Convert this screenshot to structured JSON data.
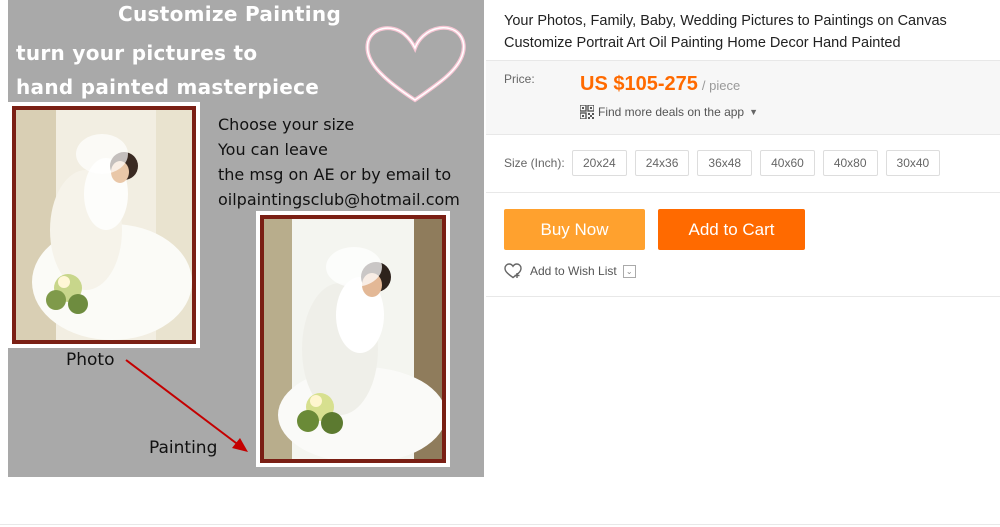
{
  "image": {
    "title": "Customize Painting",
    "subtitle_lines": [
      "turn your pictures to",
      "hand painted masterpiece"
    ],
    "instructions": [
      "Choose your size",
      "You can leave",
      "the msg on AE or by email to",
      "oilpaintingsclub@hotmail.com"
    ],
    "photo_label": "Photo",
    "painting_label": "Painting"
  },
  "product": {
    "title": "Your Photos, Family, Baby, Wedding Pictures to Paintings on Canvas Customize Portrait Art Oil Painting Home Decor Hand Painted",
    "price_label": "Price:",
    "price": "US $105-275",
    "price_unit": "/ piece",
    "app_deals": "Find more deals on the app",
    "size_label": "Size (Inch):",
    "sizes": [
      "20x24",
      "24x36",
      "36x48",
      "40x60",
      "40x80",
      "30x40"
    ],
    "buy_now": "Buy Now",
    "add_to_cart": "Add to Cart",
    "wishlist": "Add to Wish List"
  },
  "colors": {
    "accent": "#ff6a00",
    "buy_now": "#ffa12e",
    "image_bg": "#a9a9a9"
  },
  "icons": [
    "heart-outline-icon",
    "qr-code-icon",
    "caret-down-icon",
    "wishlist-heart-icon",
    "chevron-down-icon"
  ]
}
